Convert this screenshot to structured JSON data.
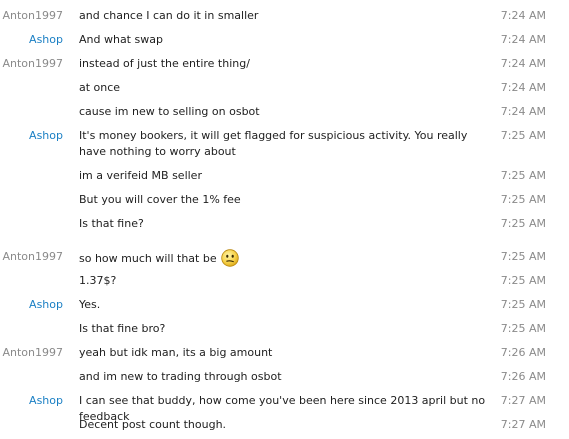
{
  "messages": [
    {
      "sender": "Anton1997",
      "text": "and chance I can do it in smaller",
      "time": "7:24 AM"
    },
    {
      "sender": "Ashop",
      "text": "And what swap",
      "time": "7:24 AM"
    },
    {
      "sender": "Anton1997",
      "text": "instead of just the entire thing/",
      "time": "7:24 AM"
    },
    {
      "sender": "",
      "text": "at once",
      "time": "7:24 AM"
    },
    {
      "sender": "",
      "text": "cause im new to selling on osbot",
      "time": "7:24 AM"
    },
    {
      "sender": "Ashop",
      "text": "It's money bookers, it will get flagged for suspicious activity. You really have nothing to worry about",
      "time": "7:25 AM"
    },
    {
      "sender": "",
      "text": "im a verifeid MB seller",
      "time": "7:25 AM"
    },
    {
      "sender": "",
      "text": "But you will cover the 1% fee",
      "time": "7:25 AM"
    },
    {
      "sender": "",
      "text": "Is that fine?",
      "time": "7:25 AM"
    },
    {
      "sender": "Anton1997",
      "text": "so how much will that be",
      "time": "7:25 AM",
      "emoticon": "confused-face-icon"
    },
    {
      "sender": "",
      "text": "1.37$?",
      "time": "7:25 AM"
    },
    {
      "sender": "Ashop",
      "text": "Yes.",
      "time": "7:25 AM"
    },
    {
      "sender": "",
      "text": "Is that fine bro?",
      "time": "7:25 AM"
    },
    {
      "sender": "Anton1997",
      "text": "yeah but idk man, its a big amount",
      "time": "7:26 AM"
    },
    {
      "sender": "",
      "text": "and im new to trading through osbot",
      "time": "7:26 AM"
    },
    {
      "sender": "Ashop",
      "text": "I can see that buddy, how come you've been here since 2013 april but no feedback",
      "time": "7:27 AM"
    },
    {
      "sender": "",
      "text": "Decent post count though.",
      "time": "7:27 AM"
    }
  ],
  "colors": {
    "sender_anton": "#8a8a8a",
    "sender_ashop": "#1a7fc4",
    "text": "#1e1e1e",
    "timestamp": "#8a8a8a"
  }
}
